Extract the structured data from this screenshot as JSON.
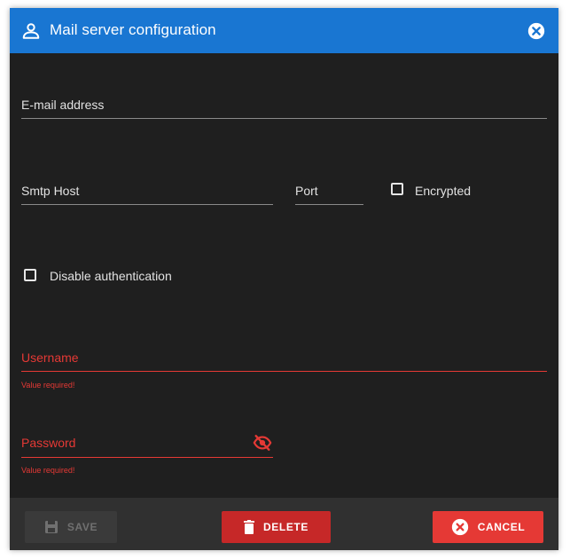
{
  "dialog": {
    "title": "Mail server configuration",
    "fields": {
      "email": {
        "label": "E-mail address",
        "value": ""
      },
      "smtp_host": {
        "label": "Smtp Host",
        "value": ""
      },
      "port": {
        "label": "Port",
        "value": ""
      },
      "encrypted": {
        "label": "Encrypted",
        "checked": false
      },
      "disable_auth": {
        "label": "Disable authentication",
        "checked": false
      },
      "username": {
        "label": "Username",
        "value": "",
        "error": "Value required!"
      },
      "password": {
        "label": "Password",
        "value": "",
        "error": "Value required!"
      }
    },
    "buttons": {
      "save": "SAVE",
      "delete": "DELETE",
      "cancel": "CANCEL"
    },
    "icons": {
      "title": "account-icon",
      "close": "close-circle-icon",
      "password_toggle": "eye-off-icon",
      "save": "floppy-icon",
      "delete": "trash-icon",
      "cancel": "close-circle-icon"
    },
    "colors": {
      "header": "#1976d2",
      "background": "#1f1f1f",
      "footer": "#303030",
      "error": "#e53935",
      "delete": "#c62828",
      "cancel": "#e53935"
    }
  }
}
